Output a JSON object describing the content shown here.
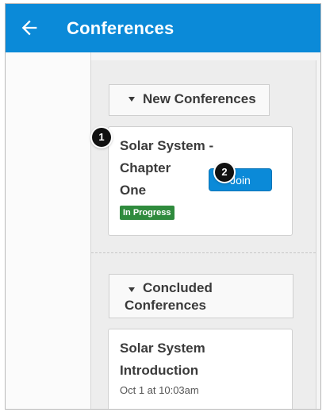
{
  "header": {
    "title": "Conferences",
    "back_icon": "arrow-left-icon",
    "bg_color": "#0b8ad8"
  },
  "sections": {
    "new": {
      "label": "New Conferences",
      "conference": {
        "line1": "Solar System -",
        "line2": "Chapter",
        "line3": "One",
        "status": "In Progress",
        "join_label": "Join"
      }
    },
    "concluded": {
      "label_line1": "Concluded",
      "label_line2": "Conferences",
      "conference": {
        "line1": "Solar System",
        "line2": "Introduction",
        "date": "Oct 1 at 10:03am"
      }
    }
  },
  "callouts": [
    "1",
    "2"
  ],
  "colors": {
    "accent": "#0b8ad8",
    "status_green": "#2f8b3d"
  }
}
